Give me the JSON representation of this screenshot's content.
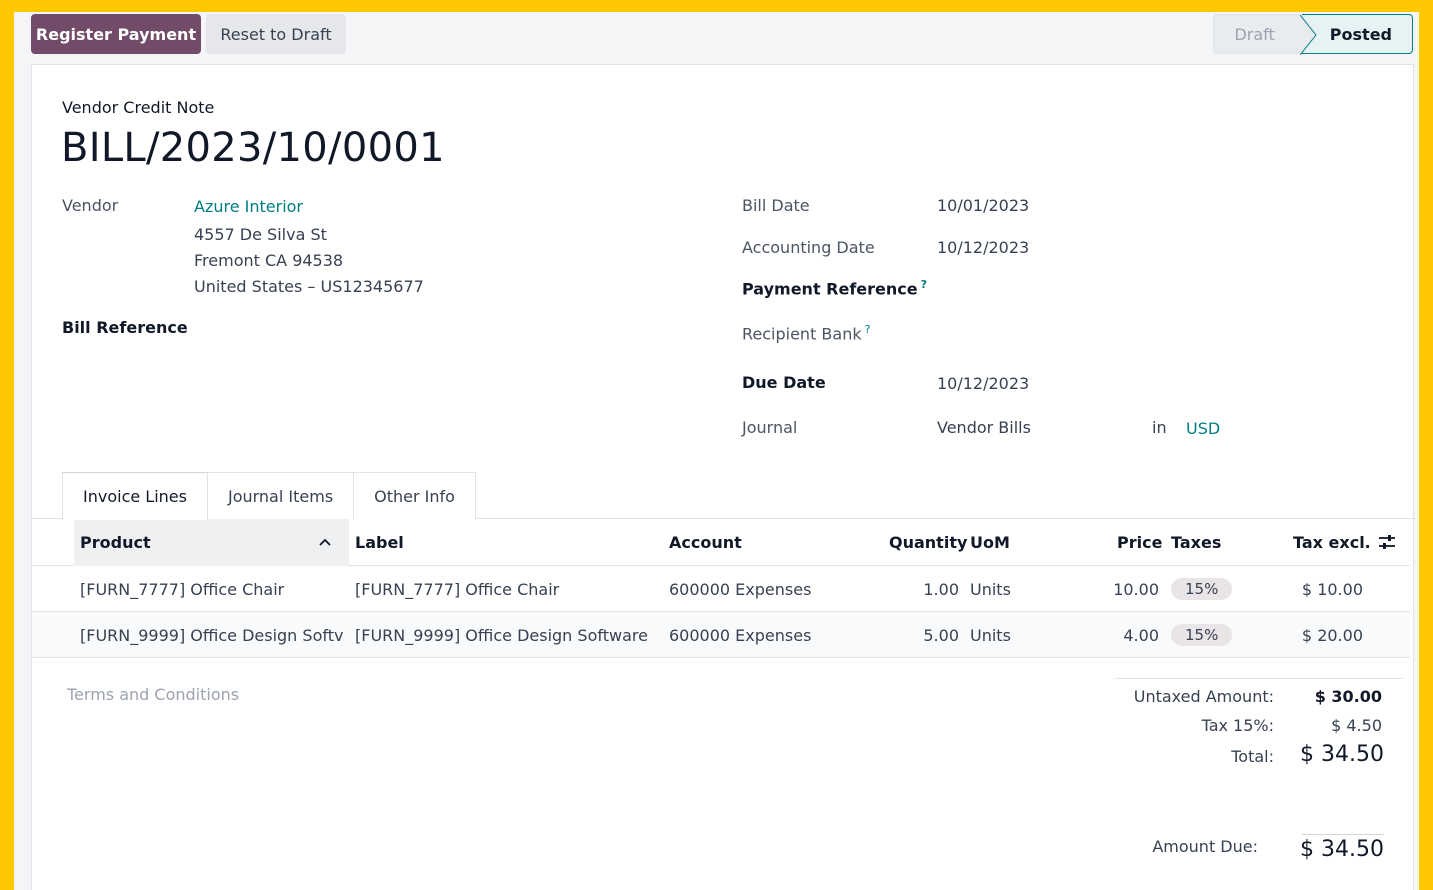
{
  "actions": {
    "register_payment": "Register Payment",
    "reset_to_draft": "Reset to Draft"
  },
  "status": {
    "stages": [
      "Draft",
      "Posted"
    ],
    "current": "Posted"
  },
  "document": {
    "type": "Vendor Credit Note",
    "name": "BILL/2023/10/0001"
  },
  "left_fields": {
    "vendor_label": "Vendor",
    "vendor_name": "Azure Interior",
    "address_line1": "4557 De Silva St",
    "address_line2": "Fremont CA 94538",
    "address_line3": "United States – US12345677",
    "bill_reference_label": "Bill Reference"
  },
  "right_fields": {
    "bill_date_label": "Bill Date",
    "bill_date": "10/01/2023",
    "accounting_date_label": "Accounting Date",
    "accounting_date": "10/12/2023",
    "payment_reference_label": "Payment Reference",
    "recipient_bank_label": "Recipient Bank",
    "due_date_label": "Due Date",
    "due_date": "10/12/2023",
    "journal_label": "Journal",
    "journal": "Vendor Bills",
    "in_label": "in",
    "currency": "USD",
    "help_mark": "?"
  },
  "tabs": [
    "Invoice Lines",
    "Journal Items",
    "Other Info"
  ],
  "table": {
    "columns": {
      "product": "Product",
      "label": "Label",
      "account": "Account",
      "quantity": "Quantity",
      "uom": "UoM",
      "price": "Price",
      "taxes": "Taxes",
      "tax_excl": "Tax excl."
    },
    "rows": [
      {
        "product": "[FURN_7777] Office Chair",
        "label": "[FURN_7777] Office Chair",
        "account": "600000 Expenses",
        "quantity": "1.00",
        "uom": "Units",
        "price": "10.00",
        "taxes": "15%",
        "tax_excl": "$ 10.00"
      },
      {
        "product": "[FURN_9999] Office Design Softv",
        "label": "[FURN_9999] Office Design Software",
        "account": "600000 Expenses",
        "quantity": "5.00",
        "uom": "Units",
        "price": "4.00",
        "taxes": "15%",
        "tax_excl": "$ 20.00"
      }
    ]
  },
  "footer": {
    "terms_placeholder": "Terms and Conditions",
    "untaxed_label": "Untaxed Amount:",
    "untaxed_value": "$ 30.00",
    "tax_label": "Tax 15%:",
    "tax_value": "$ 4.50",
    "total_label": "Total:",
    "total_value": "$ 34.50",
    "amount_due_label": "Amount Due:",
    "amount_due_value": "$ 34.50"
  },
  "colors": {
    "primary": "#714B67",
    "link": "#017E84",
    "frame": "#FFC800"
  }
}
